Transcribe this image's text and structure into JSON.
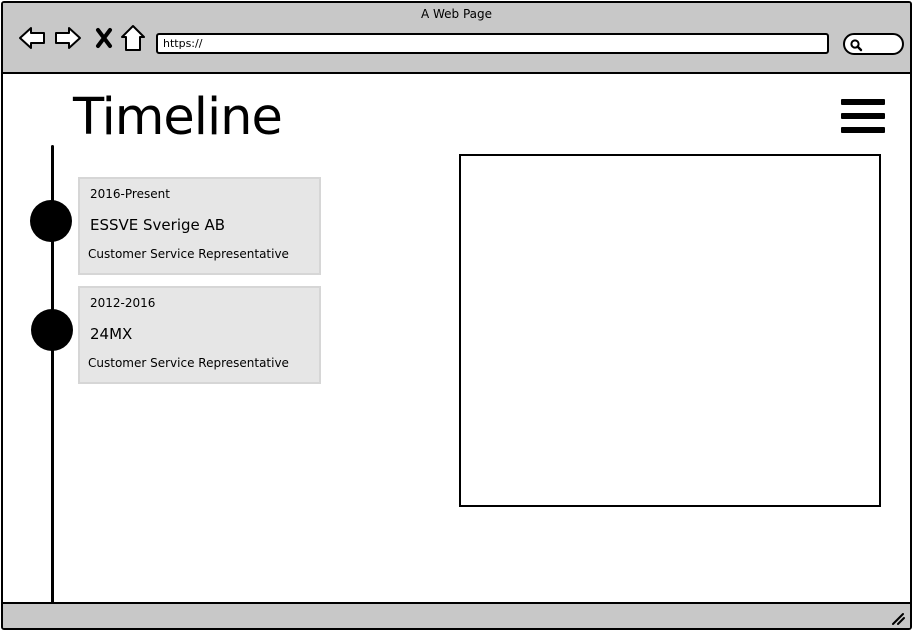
{
  "window": {
    "title": "A Web Page"
  },
  "toolbar": {
    "back_icon": "back-arrow-icon",
    "forward_icon": "forward-arrow-icon",
    "stop_icon": "close-icon",
    "home_icon": "home-icon",
    "url": "https://",
    "search_icon": "search-icon"
  },
  "page": {
    "title": "Timeline",
    "menu_icon": "hamburger-menu-icon"
  },
  "timeline": {
    "items": [
      {
        "period": "2016-Present",
        "company": "ESSVE Sverige AB",
        "role": "Customer Service Representative"
      },
      {
        "period": "2012-2016",
        "company": "24MX",
        "role": "Customer Service Representative"
      }
    ]
  },
  "colors": {
    "chrome_bg": "#c8c8c8",
    "card_bg": "#e6e6e6",
    "card_border": "#d6d6d6",
    "ink": "#000000"
  }
}
